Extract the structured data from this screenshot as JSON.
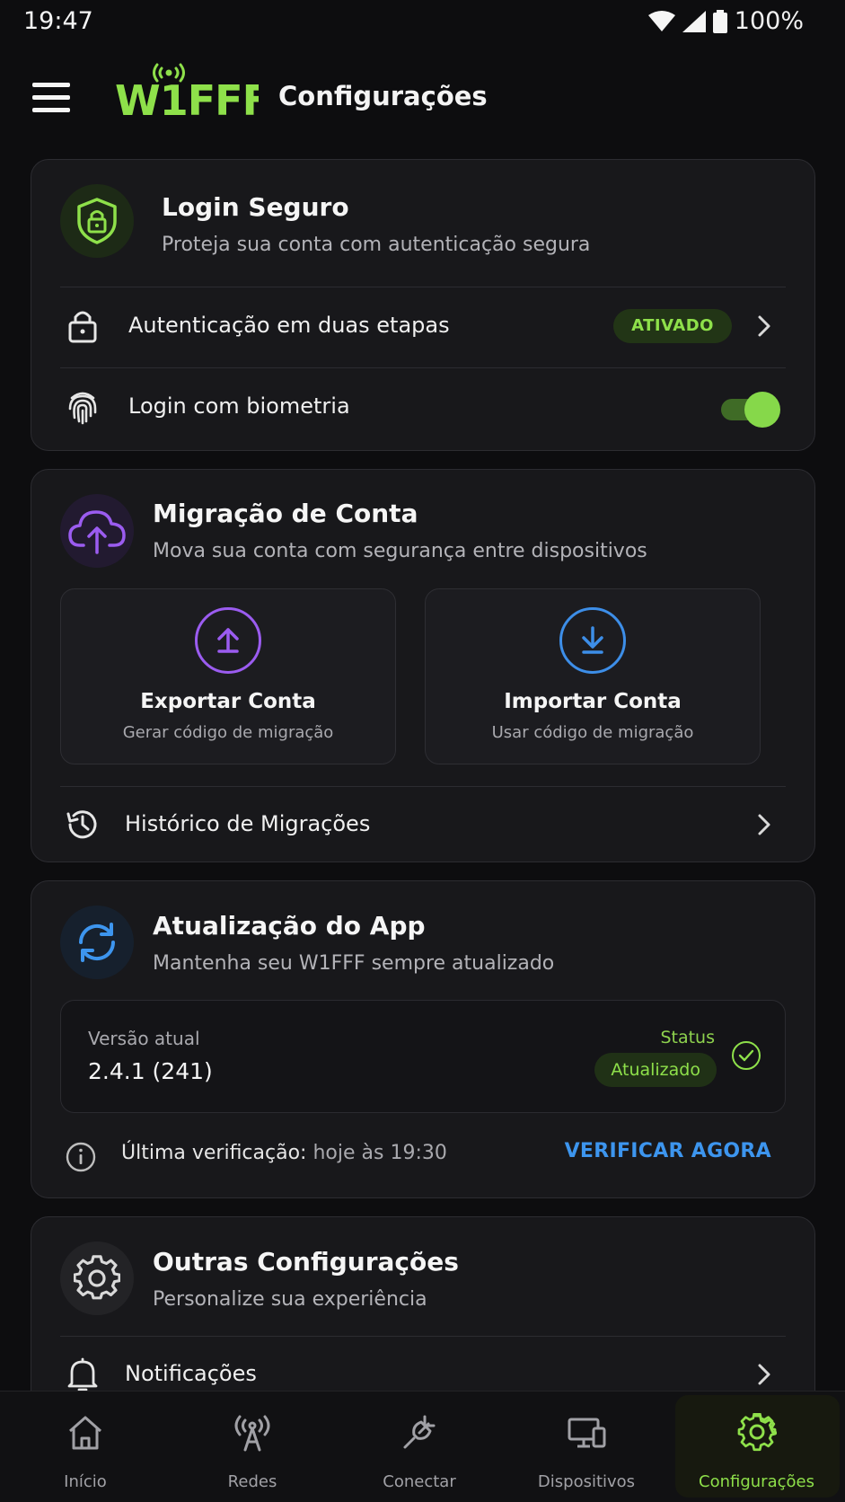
{
  "status_bar": {
    "time": "19:47",
    "battery": "100%"
  },
  "app_bar": {
    "logo_text": "W1FFF",
    "title": "Configurações"
  },
  "secure_login": {
    "title": "Login Seguro",
    "subtitle": "Proteja sua conta com autenticação segura",
    "two_factor": {
      "label": "Autenticação em duas etapas",
      "badge": "ATIVADO"
    },
    "biometric": {
      "label": "Login com biometria",
      "enabled": true
    }
  },
  "migration": {
    "title": "Migração de Conta",
    "subtitle": "Mova sua conta com segurança entre dispositivos",
    "export": {
      "title": "Exportar Conta",
      "subtitle": "Gerar código de migração"
    },
    "import": {
      "title": "Importar Conta",
      "subtitle": "Usar código de migração"
    },
    "history_label": "Histórico de Migrações"
  },
  "update": {
    "title": "Atualização do App",
    "subtitle": "Mantenha seu W1FFF sempre atualizado",
    "version_label": "Versão atual",
    "version_value": "2.4.1 (241)",
    "status_label": "Status",
    "status_value": "Atualizado",
    "last_check_label": "Última verificação:",
    "last_check_value": "hoje às 19:30",
    "verify_button": "VERIFICAR AGORA"
  },
  "other_settings": {
    "title": "Outras Configurações",
    "subtitle": "Personalize sua experiência",
    "notifications_label": "Notificações"
  },
  "bottom_nav": {
    "items": [
      {
        "label": "Início",
        "icon": "home-icon"
      },
      {
        "label": "Redes",
        "icon": "antenna-icon"
      },
      {
        "label": "Conectar",
        "icon": "plug-icon"
      },
      {
        "label": "Dispositivos",
        "icon": "devices-icon"
      },
      {
        "label": "Configurações",
        "icon": "gear-icon",
        "active": true
      }
    ]
  },
  "colors": {
    "accent_green": "#8ee04a",
    "accent_purple": "#9b5cf0",
    "accent_blue": "#3d95ee",
    "background": "#0d0d0f",
    "card": "#18181b"
  }
}
